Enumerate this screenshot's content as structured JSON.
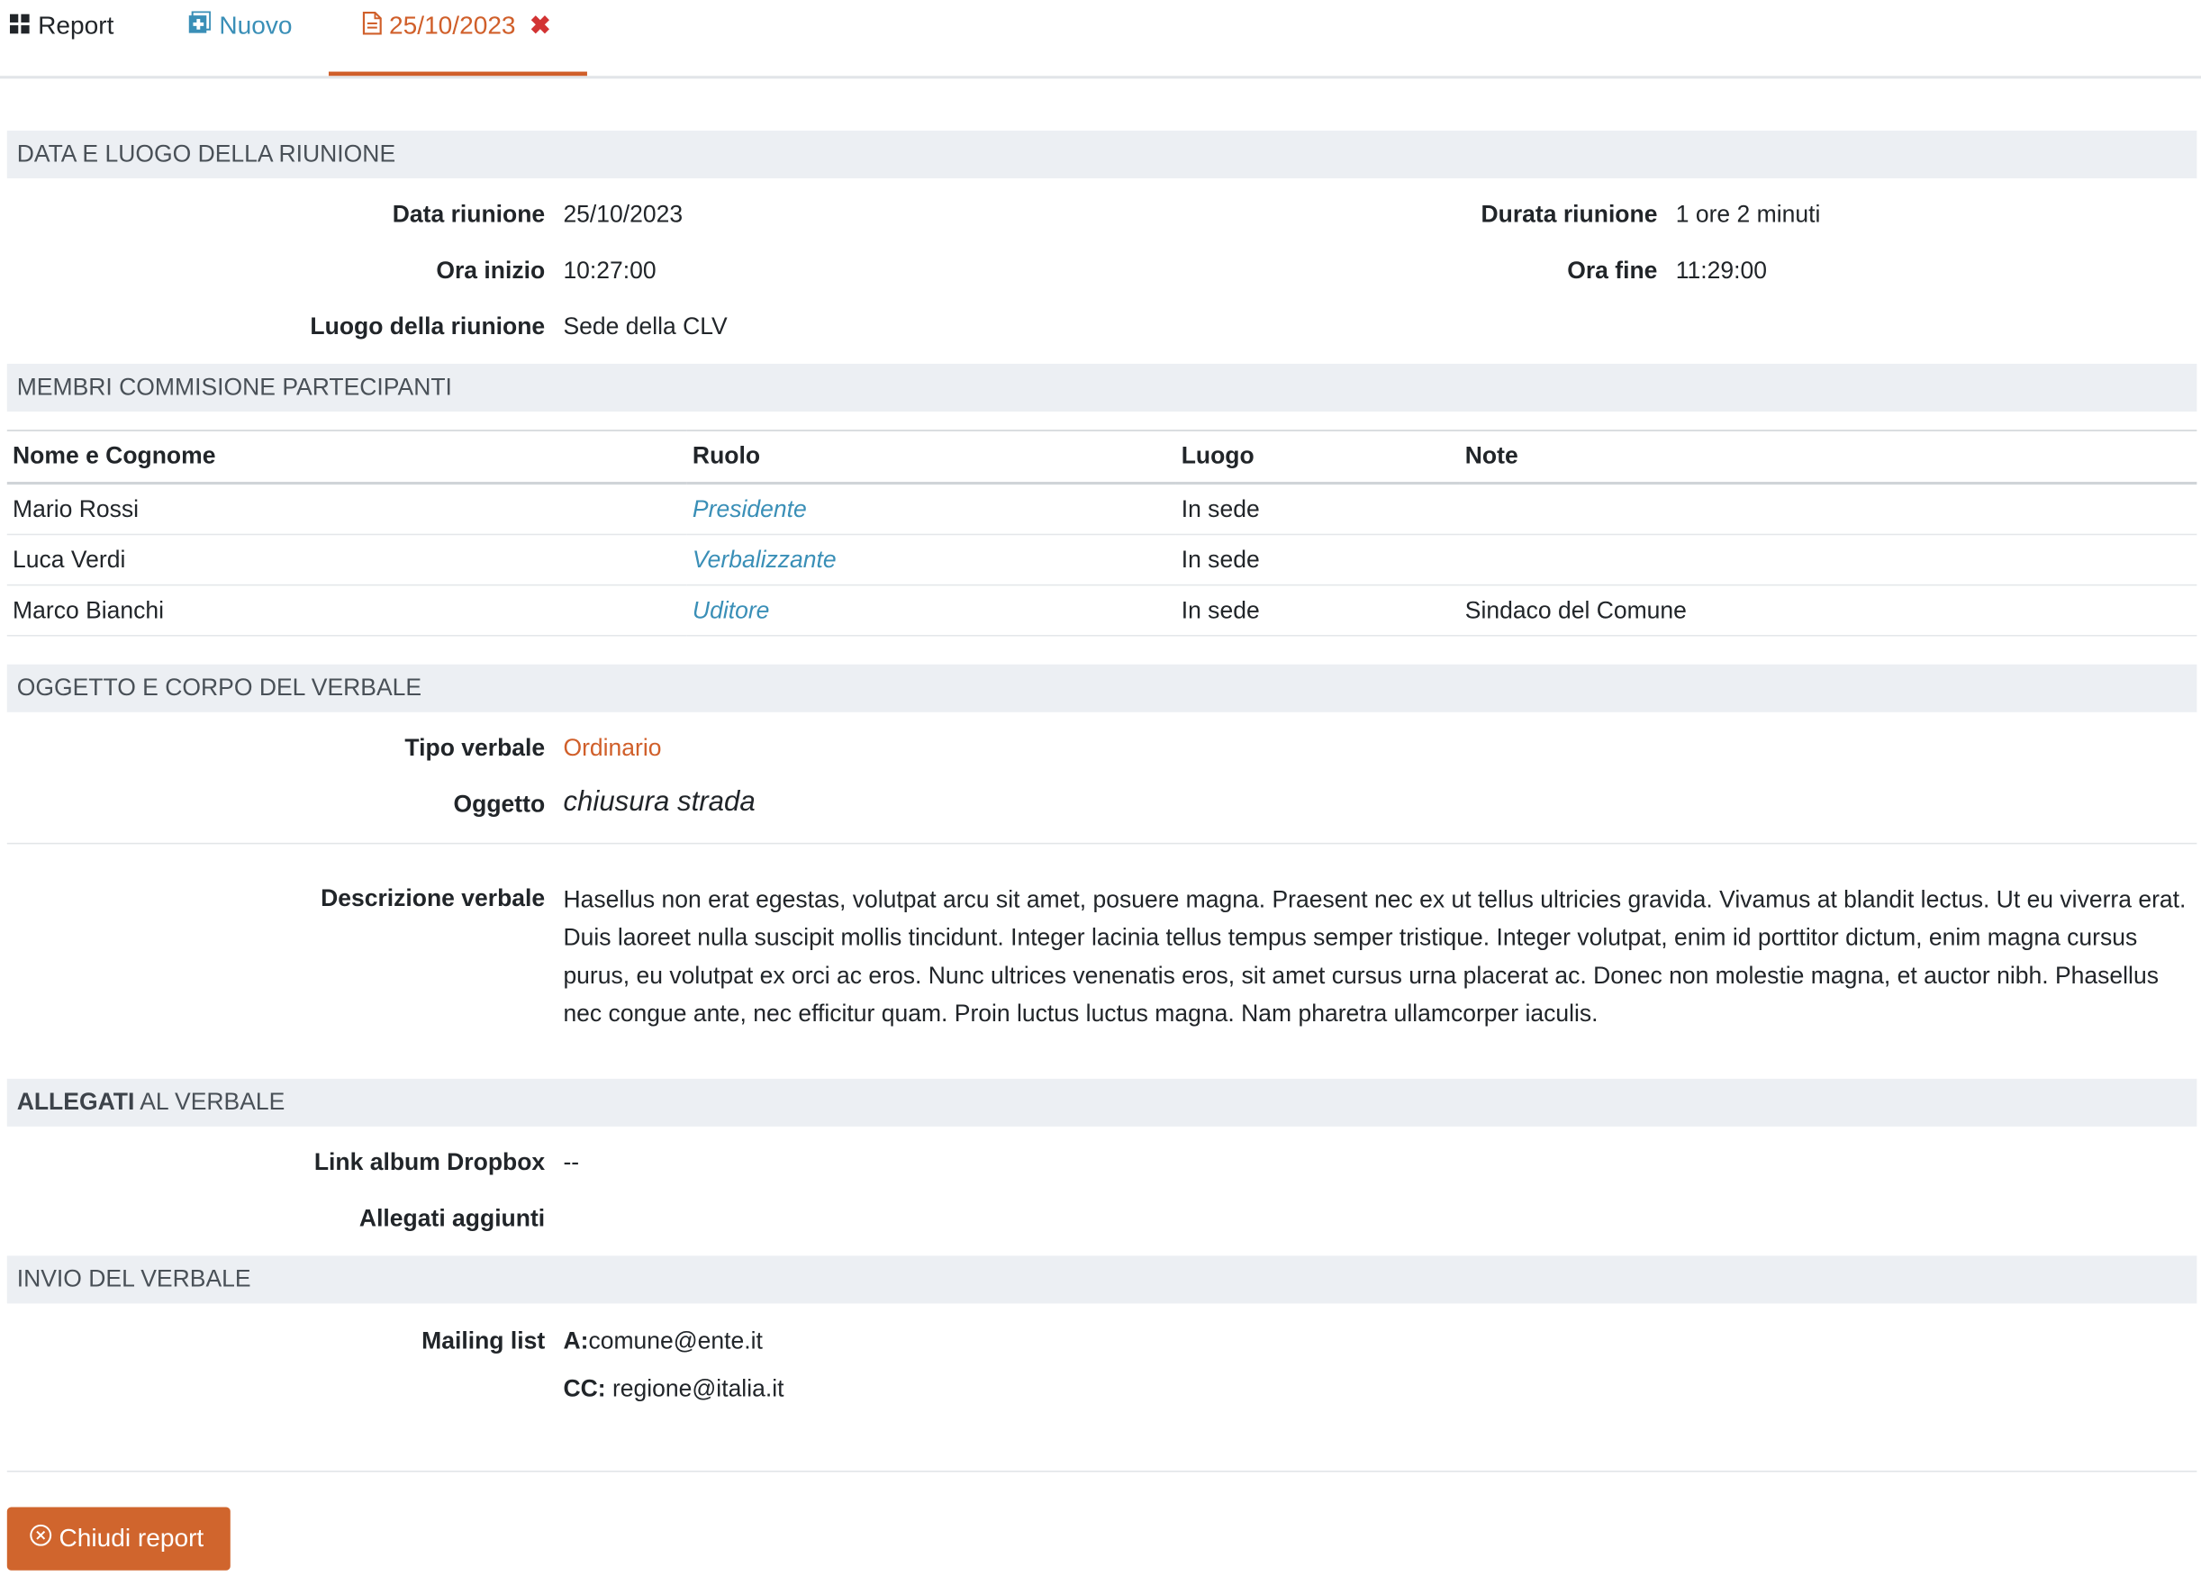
{
  "tabs": {
    "report": "Report",
    "nuovo": "Nuovo",
    "current": "25/10/2023",
    "close_glyph": "✖"
  },
  "sections": {
    "meeting": "DATA E LUOGO DELLA RIUNIONE",
    "members": "MEMBRI COMMISIONE PARTECIPANTI",
    "subject": "OGGETTO E CORPO DEL VERBALE",
    "attachments_bold": "ALLEGATI",
    "attachments_rest": " AL VERBALE",
    "send": "INVIO DEL VERBALE"
  },
  "meeting": {
    "date_label": "Data riunione",
    "date_value": "25/10/2023",
    "duration_label": "Durata riunione",
    "duration_value": "1 ore 2 minuti",
    "start_label": "Ora inizio",
    "start_value": "10:27:00",
    "end_label": "Ora fine",
    "end_value": "11:29:00",
    "place_label": "Luogo della riunione",
    "place_value": "Sede della CLV"
  },
  "members": {
    "headers": [
      "Nome e Cognome",
      "Ruolo",
      "Luogo",
      "Note"
    ],
    "rows": [
      {
        "name": "Mario Rossi",
        "role": "Presidente",
        "place": "In sede",
        "note": ""
      },
      {
        "name": "Luca Verdi",
        "role": "Verbalizzante",
        "place": "In sede",
        "note": ""
      },
      {
        "name": "Marco Bianchi",
        "role": "Uditore",
        "place": "In sede",
        "note": "Sindaco del Comune"
      }
    ]
  },
  "subject": {
    "type_label": "Tipo verbale",
    "type_value": "Ordinario",
    "object_label": "Oggetto",
    "object_value": "chiusura strada",
    "desc_label": "Descrizione verbale",
    "desc_value": "Hasellus non erat egestas, volutpat arcu sit amet, posuere magna. Praesent nec ex ut tellus ultricies gravida. Vivamus at blandit lectus. Ut eu viverra erat. Duis laoreet nulla suscipit mollis tincidunt. Integer lacinia tellus tempus semper tristique. Integer volutpat, enim id porttitor dictum, enim magna cursus purus, eu volutpat ex orci ac eros. Nunc ultrices venenatis eros, sit amet cursus urna placerat ac. Donec non molestie magna, et auctor nibh. Phasellus nec congue ante, nec efficitur quam. Proin luctus luctus magna. Nam pharetra ullamcorper iaculis."
  },
  "attachments": {
    "dropbox_label": "Link album Dropbox",
    "dropbox_value": "--",
    "added_label": "Allegati aggiunti"
  },
  "send": {
    "mailing_label": "Mailing list",
    "to_label": "A:",
    "to_value": "comune@ente.it",
    "cc_label": "CC:",
    "cc_value": " regione@italia.it"
  },
  "buttons": {
    "close_report": "Chiudi report"
  },
  "colors": {
    "accent": "#d05f2a",
    "link": "#3a8fb7",
    "section_bg": "#eceff3",
    "close_x": "#d23333"
  }
}
